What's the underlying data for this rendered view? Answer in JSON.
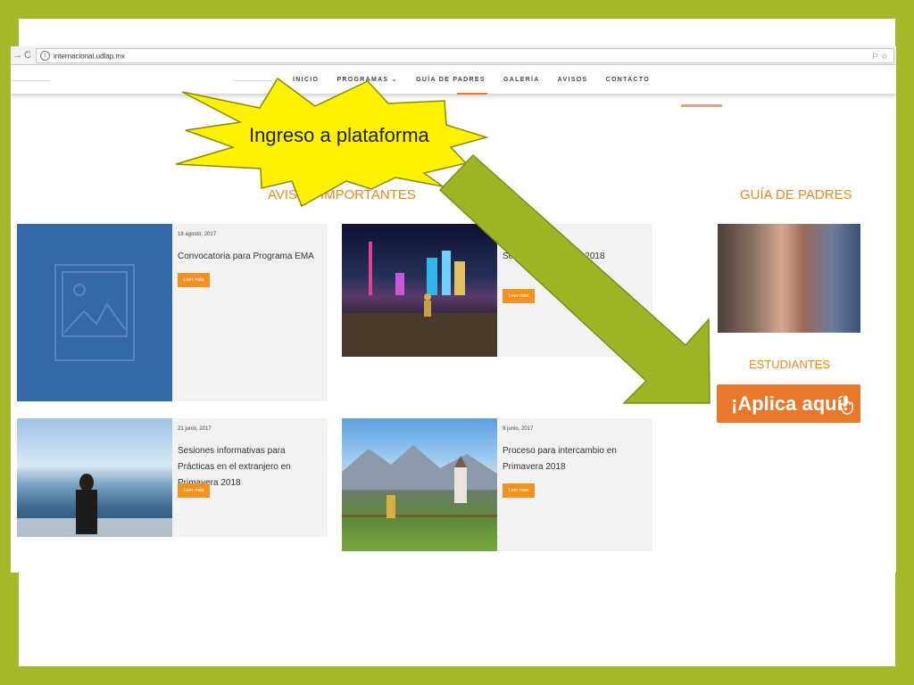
{
  "browser": {
    "url": "internacional.udlap.mx",
    "back_glyph": "→",
    "reload_glyph": "C",
    "translate_glyph": "⚐",
    "bookmark_glyph": "☆"
  },
  "nav": {
    "items": [
      "INICIO",
      "PROGRAMAS ⌄",
      "GUÍA DE PADRES",
      "GALERÍA",
      "AVISOS",
      "CONTACTO"
    ]
  },
  "avisos": {
    "title": "AVISOS IMPORTANTES",
    "cards": [
      {
        "date": "18 agosto, 2017",
        "title": "Convocatoria para Programa EMA",
        "button": "Leer más"
      },
      {
        "date": "",
        "title": "Se… intercambio … 2018",
        "button": "Leer más"
      },
      {
        "date": "21 junio, 2017",
        "title": "Sesiones informativas para Prácticas en el extranjero en Primavera 2018",
        "button": "Leer más"
      },
      {
        "date": "9 junio, 2017",
        "title": "Proceso para intercambio en Primavera 2018",
        "button": "Leer más"
      }
    ]
  },
  "sidebar": {
    "guia_title": "GUÍA DE PADRES",
    "estudiantes_title": "ESTUDIANTES",
    "aplica_button": "¡Aplica aquí!"
  },
  "annotation": {
    "star_label": "Ingreso a plataforma"
  },
  "colors": {
    "frame": "#a5b827",
    "arrow": "#9fb526",
    "star": "#fff200",
    "accent_orange": "#e8891c",
    "button_orange": "#f2911f"
  }
}
